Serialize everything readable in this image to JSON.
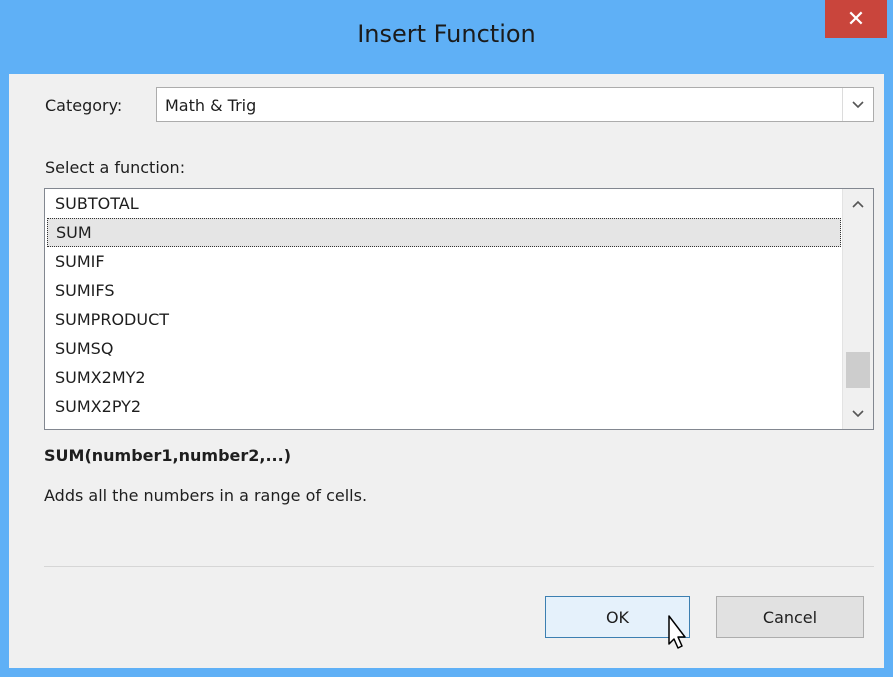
{
  "window": {
    "title": "Insert Function",
    "close_icon": "close-icon"
  },
  "category": {
    "label": "Category:",
    "selected": "Math & Trig"
  },
  "function_list": {
    "label": "Select a function:",
    "items": [
      "SUBTOTAL",
      "SUM",
      "SUMIF",
      "SUMIFS",
      "SUMPRODUCT",
      "SUMSQ",
      "SUMX2MY2",
      "SUMX2PY2"
    ],
    "selected_index": 1
  },
  "details": {
    "signature": "SUM(number1,number2,...)",
    "description": "Adds all the numbers in a range of cells."
  },
  "buttons": {
    "ok": "OK",
    "cancel": "Cancel"
  },
  "colors": {
    "titlebar": "#5fb0f6",
    "close": "#c9453c",
    "dialog": "#f0f0f0",
    "ok_border": "#3c7fb1"
  }
}
